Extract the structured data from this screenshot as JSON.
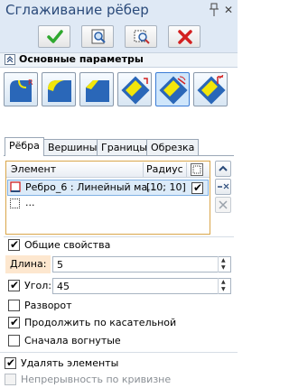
{
  "window": {
    "title": "Сглаживание рёбер"
  },
  "section": {
    "title": "Основные параметры"
  },
  "tabs": [
    "Рёбра",
    "Вершины",
    "Границы",
    "Обрезка"
  ],
  "list": {
    "col_element": "Элемент",
    "col_radius": "Радиус",
    "rows": [
      {
        "element": "Ребро_6 : Линейный ма...",
        "radius": "[10; 10]",
        "checked": true
      },
      {
        "element": "...",
        "radius": "",
        "checked": false
      }
    ]
  },
  "options": {
    "general_props": "Общие свойства",
    "length_label": "Длина:",
    "length_value": "5",
    "angle_label": "Угол:",
    "angle_value": "45",
    "reversal": "Разворот",
    "continue_tangent": "Продолжить по касательной",
    "concave_first": "Сначала вогнутые"
  },
  "footer": {
    "delete_elements": "Удалять элементы",
    "curvature_continuity": "Непрерывность по кривизне"
  },
  "colors": {
    "accent": "#3a7bd5",
    "ok": "#2fa82f",
    "cancel": "#d32020",
    "yellow": "#f2e60a"
  }
}
